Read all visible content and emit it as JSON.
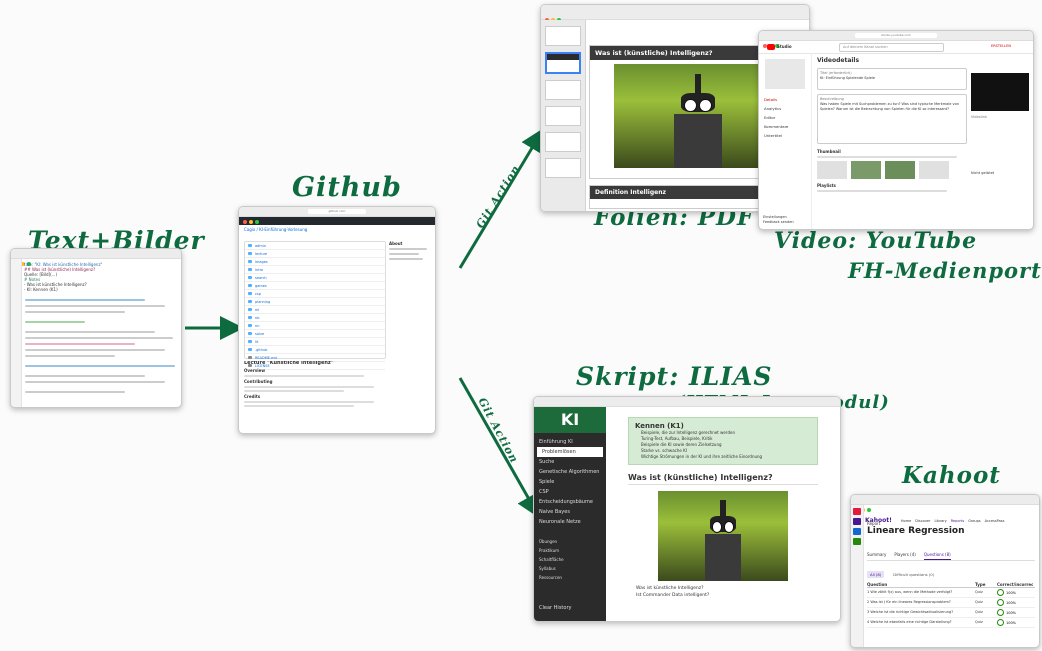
{
  "labels": {
    "textbilder": "Text+Bilder",
    "github": "Github",
    "folien": "Folien: PDF",
    "video1": "Video: YouTube",
    "video2": "FH-Medienportal",
    "skript1": "Skript: ILIAS",
    "skript2": "(HTML-Lernmodul)",
    "kahoot": "Kahoot",
    "gitaction_top": "Git Action",
    "gitaction_bottom": "Git Action"
  },
  "colors": {
    "ink": "#0e6b3f",
    "ilias_sidebar": "#2b2b2b",
    "k1_green": "#1d6b3a",
    "yt_red": "#ff0000",
    "kahoot_purple": "#46178f"
  },
  "editor": {
    "lines": [
      "title: \"KI: Was ist künstliche Intelligenz\"",
      "## Was ist (künstliche) Intelligenz?",
      "Quelle: [Bild](...)",
      "# Notes",
      "- Was ist künstliche Intelligenz?",
      "- KI: Kennen (K1)"
    ]
  },
  "github": {
    "repo": "Cagix / KI-Einführung-Vorlesung",
    "files": [
      "admin",
      "lecture",
      "images",
      "intro",
      "search",
      "games",
      "csp",
      "planning",
      "ml",
      "nb",
      "nn",
      "solve",
      "lit",
      ".github",
      "README.md",
      "LICENSE"
    ],
    "readme_title": "Lecture \"Künstliche Intelligenz\"",
    "readme_h1": "Overview",
    "readme_h2": "Contributing",
    "readme_h3": "Credits",
    "about": "About"
  },
  "pdf": {
    "slide_title": "Was ist (künstliche) Intelligenz?",
    "next_title": "Definition Intelligenz"
  },
  "youtube": {
    "studio": "Studio",
    "search": "Auf deinem Kanal suchen",
    "heading": "Videodetails",
    "title_label": "Titel (erforderlich)",
    "title_value": "KI: Einführung Spielende Spiele",
    "desc_label": "Beschreibung",
    "desc_value": "Was haben Spiele mit Suchproblemen zu tun? Was sind typische Merkmale von Spielen? Warum ist die Betrachtung von Spielen für die KI so interessant?",
    "thumb_label": "Thumbnail",
    "playlist_label": "Playlists",
    "side_items": [
      "Details",
      "Analytics",
      "Editor",
      "Kommentare",
      "Untertitel"
    ],
    "side_bottom": [
      "Einstellungen",
      "Feedback senden"
    ],
    "link_label": "Videolink",
    "visibility": "Nicht gelistet",
    "create": "ERSTELLEN"
  },
  "ilias": {
    "logo": "KI",
    "menu": [
      "Einführung KI",
      "Problemlösen",
      "Suche",
      "Genetische Algorithmen",
      "Spiele",
      "CSP",
      "Entscheidungsbäume",
      "Naive Bayes",
      "Neuronale Netze"
    ],
    "section2": [
      "Übungen",
      "Praktikum",
      "Schaltfläche",
      "Syllabus",
      "Ressourcen"
    ],
    "kennen_title": "Kennen (K1)",
    "kennen_items": [
      "Beispiele, die zur Intelligenz gerechnet werden",
      "Turing-Test, Aufbau, Beispiele, Kritik",
      "Beispiele die KI sowie deren Zielsetzung",
      "Starke vs. schwache KI",
      "Wichtige Strömungen in der KI und ihre zeitliche Einordnung"
    ],
    "h2": "Was ist (künstliche) Intelligenz?",
    "bullets": [
      "Was ist künstliche Intelligenz?",
      "Ist Commander Data intelligent?"
    ],
    "clear_history": "Clear History"
  },
  "kahoot": {
    "brand": "Kahoot!",
    "nav": [
      "Home",
      "Discover",
      "Library",
      "Reports",
      "Groups",
      "AccessPass"
    ],
    "report_label": "Report",
    "title": "Lineare Regression",
    "tabs": [
      "Summary",
      "Players (4)",
      "Questions (8)"
    ],
    "subtabs": [
      "All (8)",
      "Difficult questions (0)"
    ],
    "cols": [
      "Question",
      "Type",
      "Correct/incorrect"
    ],
    "rows": [
      {
        "q": "1  Wie zählt f(x) aus, wenn die Methode verfolgt?",
        "t": "Quiz",
        "c": "100%"
      },
      {
        "q": "2  Was ist J für ein lineares Regressionsproblem?",
        "t": "Quiz",
        "c": "100%"
      },
      {
        "q": "3  Welche ist die richtige Gewichtsaktualisierung?",
        "t": "Quiz",
        "c": "100%"
      },
      {
        "q": "4  Welche ist ebenfalls eine richtige Darstellung?",
        "t": "Quiz",
        "c": "100%"
      }
    ]
  }
}
